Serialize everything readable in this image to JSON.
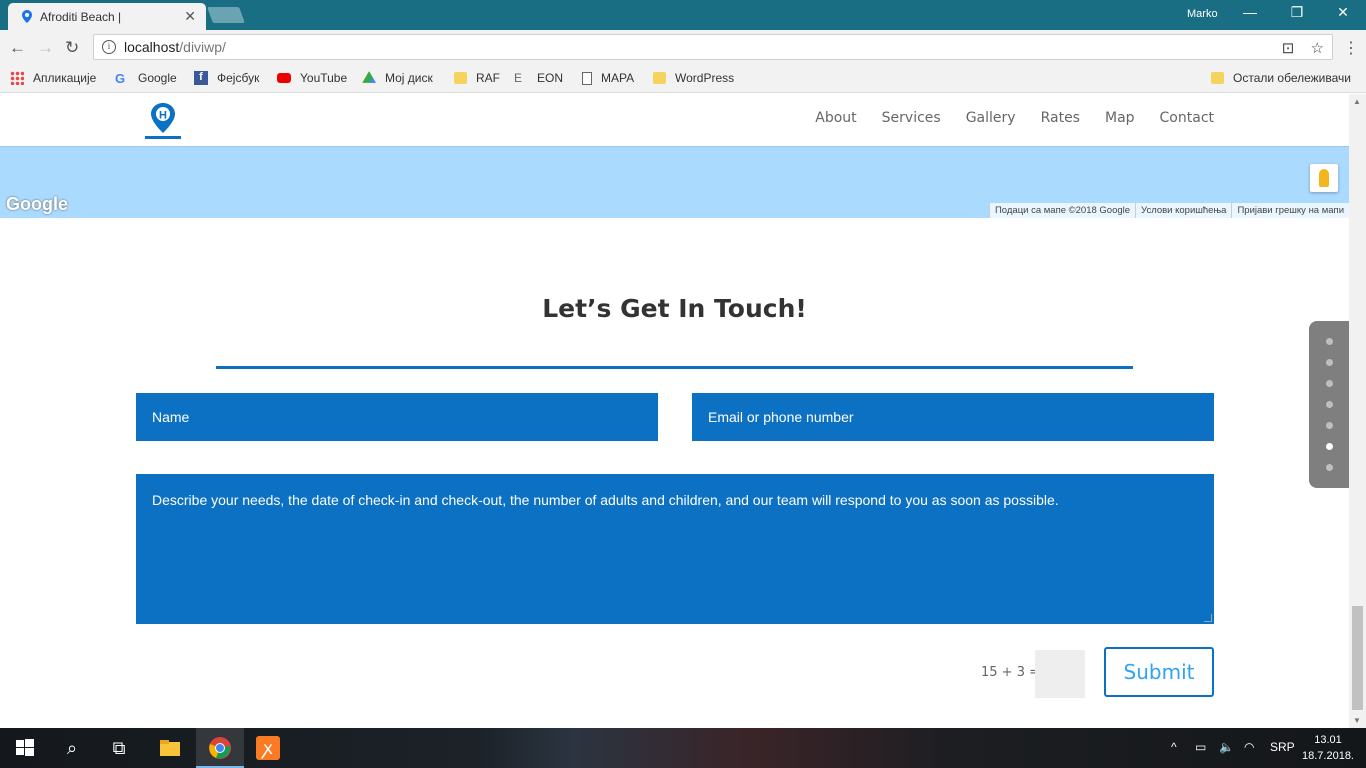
{
  "browser": {
    "tab_title": "Afroditi Beach |",
    "url_host": "localhost",
    "url_path": "/diviwp/",
    "user": "Marko"
  },
  "bookmarks": [
    "Апликације",
    "Google",
    "Фејсбук",
    "YouTube",
    "Мој диск",
    "RAF",
    "EON",
    "MAPA",
    "WordPress"
  ],
  "bookmarks_other": "Остали обележивачи",
  "nav": [
    "About",
    "Services",
    "Gallery",
    "Rates",
    "Map",
    "Contact"
  ],
  "logo_letter": "H",
  "map": {
    "google_label": "Google",
    "attribution": [
      "Подаци са мапе ©2018 Google",
      "Услови коришћења",
      "Пријави грешку на мапи"
    ]
  },
  "contact": {
    "heading": "Let’s Get In Touch!",
    "name_placeholder": "Name",
    "email_placeholder": "Email or phone number",
    "message_placeholder": "Describe your needs, the date of check-in and check-out, the number of adults and children, and our team will respond to you as soon as possible.",
    "captcha": "15 + 3 =",
    "submit": "Submit"
  },
  "taskbar": {
    "lang": "SRP",
    "time": "13.01",
    "date": "18.7.2018."
  },
  "colors": {
    "accent": "#0c71c3",
    "submit_text": "#2ea3f2",
    "map_water": "#abdaff",
    "titlebar": "#1a6e83"
  }
}
